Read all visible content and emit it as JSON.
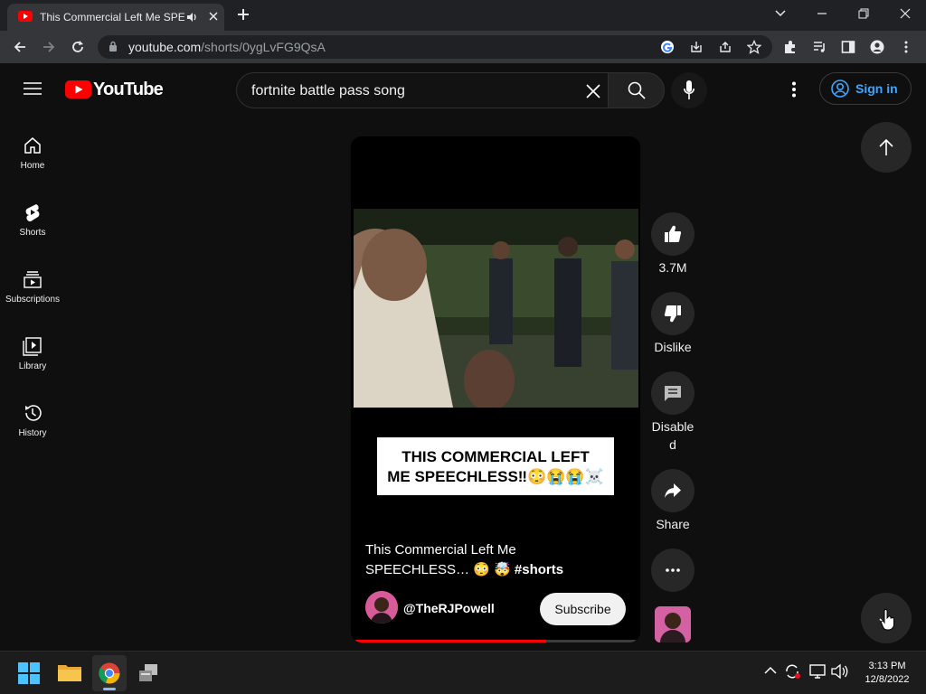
{
  "browser": {
    "tab_title": "This Commercial Left Me SPEECHLESS",
    "url_host": "youtube.com",
    "url_path": "/shorts/0ygLvFG9QsA"
  },
  "header": {
    "logo": "YouTube",
    "search_value": "fortnite battle pass song",
    "signin_label": "Sign in"
  },
  "sidebar": {
    "items": [
      {
        "label": "Home"
      },
      {
        "label": "Shorts"
      },
      {
        "label": "Subscriptions"
      },
      {
        "label": "Library"
      },
      {
        "label": "History"
      }
    ]
  },
  "short": {
    "caption_line1": "THIS COMMERCIAL LEFT",
    "caption_line2": "ME SPEECHLESS‼😳😭😭☠️",
    "title_line1": "This Commercial Left Me",
    "title_line2": "SPEECHLESS… 😳 🤯",
    "hashtag": "#shorts",
    "channel": "@TheRJPowell",
    "subscribe_label": "Subscribe",
    "progress": 0.68
  },
  "actions": {
    "like_count": "3.7M",
    "dislike_label": "Dislike",
    "comments_label_1": "Disable",
    "comments_label_2": "d",
    "share_label": "Share"
  },
  "taskbar": {
    "time": "3:13 PM",
    "date": "12/8/2022"
  },
  "colors": {
    "accent_red": "#ff0000",
    "link_blue": "#3ea6ff",
    "background": "#0f0f0f"
  }
}
